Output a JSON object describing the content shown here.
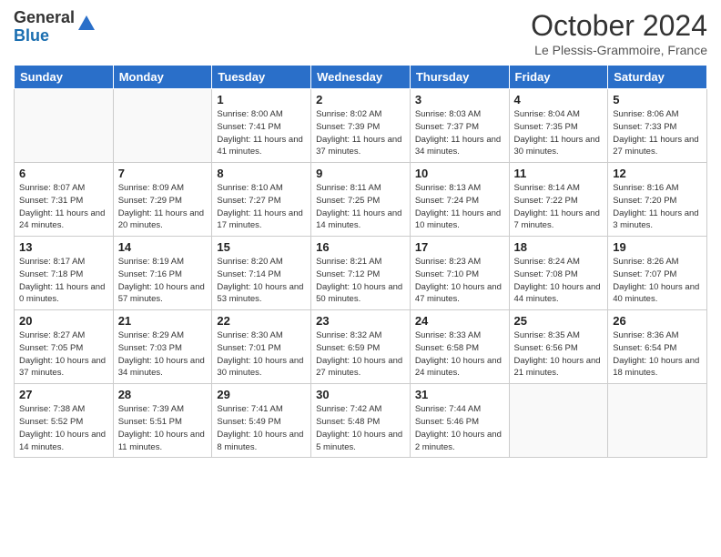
{
  "logo": {
    "general": "General",
    "blue": "Blue"
  },
  "header": {
    "month": "October 2024",
    "location": "Le Plessis-Grammoire, France"
  },
  "weekdays": [
    "Sunday",
    "Monday",
    "Tuesday",
    "Wednesday",
    "Thursday",
    "Friday",
    "Saturday"
  ],
  "weeks": [
    [
      {
        "day": "",
        "info": ""
      },
      {
        "day": "",
        "info": ""
      },
      {
        "day": "1",
        "info": "Sunrise: 8:00 AM\nSunset: 7:41 PM\nDaylight: 11 hours and 41 minutes."
      },
      {
        "day": "2",
        "info": "Sunrise: 8:02 AM\nSunset: 7:39 PM\nDaylight: 11 hours and 37 minutes."
      },
      {
        "day": "3",
        "info": "Sunrise: 8:03 AM\nSunset: 7:37 PM\nDaylight: 11 hours and 34 minutes."
      },
      {
        "day": "4",
        "info": "Sunrise: 8:04 AM\nSunset: 7:35 PM\nDaylight: 11 hours and 30 minutes."
      },
      {
        "day": "5",
        "info": "Sunrise: 8:06 AM\nSunset: 7:33 PM\nDaylight: 11 hours and 27 minutes."
      }
    ],
    [
      {
        "day": "6",
        "info": "Sunrise: 8:07 AM\nSunset: 7:31 PM\nDaylight: 11 hours and 24 minutes."
      },
      {
        "day": "7",
        "info": "Sunrise: 8:09 AM\nSunset: 7:29 PM\nDaylight: 11 hours and 20 minutes."
      },
      {
        "day": "8",
        "info": "Sunrise: 8:10 AM\nSunset: 7:27 PM\nDaylight: 11 hours and 17 minutes."
      },
      {
        "day": "9",
        "info": "Sunrise: 8:11 AM\nSunset: 7:25 PM\nDaylight: 11 hours and 14 minutes."
      },
      {
        "day": "10",
        "info": "Sunrise: 8:13 AM\nSunset: 7:24 PM\nDaylight: 11 hours and 10 minutes."
      },
      {
        "day": "11",
        "info": "Sunrise: 8:14 AM\nSunset: 7:22 PM\nDaylight: 11 hours and 7 minutes."
      },
      {
        "day": "12",
        "info": "Sunrise: 8:16 AM\nSunset: 7:20 PM\nDaylight: 11 hours and 3 minutes."
      }
    ],
    [
      {
        "day": "13",
        "info": "Sunrise: 8:17 AM\nSunset: 7:18 PM\nDaylight: 11 hours and 0 minutes."
      },
      {
        "day": "14",
        "info": "Sunrise: 8:19 AM\nSunset: 7:16 PM\nDaylight: 10 hours and 57 minutes."
      },
      {
        "day": "15",
        "info": "Sunrise: 8:20 AM\nSunset: 7:14 PM\nDaylight: 10 hours and 53 minutes."
      },
      {
        "day": "16",
        "info": "Sunrise: 8:21 AM\nSunset: 7:12 PM\nDaylight: 10 hours and 50 minutes."
      },
      {
        "day": "17",
        "info": "Sunrise: 8:23 AM\nSunset: 7:10 PM\nDaylight: 10 hours and 47 minutes."
      },
      {
        "day": "18",
        "info": "Sunrise: 8:24 AM\nSunset: 7:08 PM\nDaylight: 10 hours and 44 minutes."
      },
      {
        "day": "19",
        "info": "Sunrise: 8:26 AM\nSunset: 7:07 PM\nDaylight: 10 hours and 40 minutes."
      }
    ],
    [
      {
        "day": "20",
        "info": "Sunrise: 8:27 AM\nSunset: 7:05 PM\nDaylight: 10 hours and 37 minutes."
      },
      {
        "day": "21",
        "info": "Sunrise: 8:29 AM\nSunset: 7:03 PM\nDaylight: 10 hours and 34 minutes."
      },
      {
        "day": "22",
        "info": "Sunrise: 8:30 AM\nSunset: 7:01 PM\nDaylight: 10 hours and 30 minutes."
      },
      {
        "day": "23",
        "info": "Sunrise: 8:32 AM\nSunset: 6:59 PM\nDaylight: 10 hours and 27 minutes."
      },
      {
        "day": "24",
        "info": "Sunrise: 8:33 AM\nSunset: 6:58 PM\nDaylight: 10 hours and 24 minutes."
      },
      {
        "day": "25",
        "info": "Sunrise: 8:35 AM\nSunset: 6:56 PM\nDaylight: 10 hours and 21 minutes."
      },
      {
        "day": "26",
        "info": "Sunrise: 8:36 AM\nSunset: 6:54 PM\nDaylight: 10 hours and 18 minutes."
      }
    ],
    [
      {
        "day": "27",
        "info": "Sunrise: 7:38 AM\nSunset: 5:52 PM\nDaylight: 10 hours and 14 minutes."
      },
      {
        "day": "28",
        "info": "Sunrise: 7:39 AM\nSunset: 5:51 PM\nDaylight: 10 hours and 11 minutes."
      },
      {
        "day": "29",
        "info": "Sunrise: 7:41 AM\nSunset: 5:49 PM\nDaylight: 10 hours and 8 minutes."
      },
      {
        "day": "30",
        "info": "Sunrise: 7:42 AM\nSunset: 5:48 PM\nDaylight: 10 hours and 5 minutes."
      },
      {
        "day": "31",
        "info": "Sunrise: 7:44 AM\nSunset: 5:46 PM\nDaylight: 10 hours and 2 minutes."
      },
      {
        "day": "",
        "info": ""
      },
      {
        "day": "",
        "info": ""
      }
    ]
  ]
}
